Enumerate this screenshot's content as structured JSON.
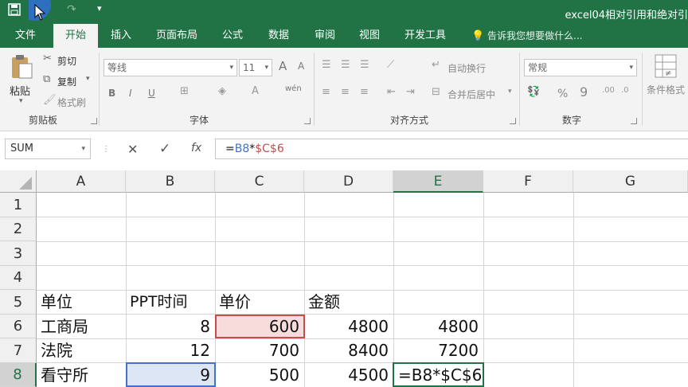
{
  "title_bar": {
    "title": "excel04相对引用和绝对引",
    "save_icon": "save-icon",
    "undo_icon": "undo-icon",
    "redo_icon": "redo-icon",
    "customize": "▾"
  },
  "tabs": [
    "文件",
    "开始",
    "插入",
    "页面布局",
    "公式",
    "数据",
    "审阅",
    "视图",
    "开发工具"
  ],
  "active_tab": "开始",
  "tell_me": "告诉我您想要做什么...",
  "ribbon": {
    "clipboard": {
      "label": "剪贴板",
      "paste": "粘贴",
      "cut": "剪切",
      "copy": "复制",
      "format_painter": "格式刷"
    },
    "font": {
      "label": "字体",
      "font_name": "等线",
      "font_size": "11",
      "grow": "A",
      "shrink": "A",
      "bold": "B",
      "italic": "I",
      "underline": "U",
      "wen": "wén"
    },
    "alignment": {
      "label": "对齐方式",
      "wrap": "自动换行",
      "merge": "合并后居中"
    },
    "number": {
      "label": "数字",
      "format": "常规",
      "percent": "%",
      "comma": "9"
    },
    "styles": {
      "conditional": "条件格式"
    }
  },
  "formula_bar": {
    "name_box": "SUM",
    "cancel": "✕",
    "enter": "✓",
    "fx": "fx",
    "formula_prefix": "=",
    "formula_ref1": "B8",
    "formula_op": "*",
    "formula_ref2": "$C$6"
  },
  "columns": [
    "A",
    "B",
    "C",
    "D",
    "E",
    "F",
    "G"
  ],
  "rows": [
    "1",
    "2",
    "3",
    "4",
    "5",
    "6",
    "7",
    "8"
  ],
  "selected_column": "E",
  "selected_row": "8",
  "cells": {
    "A5": "单位",
    "B5": "PPT时间",
    "C5": "单价",
    "D5": "金额",
    "A6": "工商局",
    "B6": "8",
    "C6": "600",
    "D6": "4800",
    "E6": "4800",
    "A7": "法院",
    "B7": "12",
    "C7": "700",
    "D7": "8400",
    "E7": "7200",
    "A8": "看守所",
    "B8": "9",
    "C8": "500",
    "D8": "4500",
    "E8": "=B8*$C$6"
  },
  "colors": {
    "excel_green": "#217346",
    "ref_blue": "#4472c4",
    "ref_red": "#c0504d"
  }
}
